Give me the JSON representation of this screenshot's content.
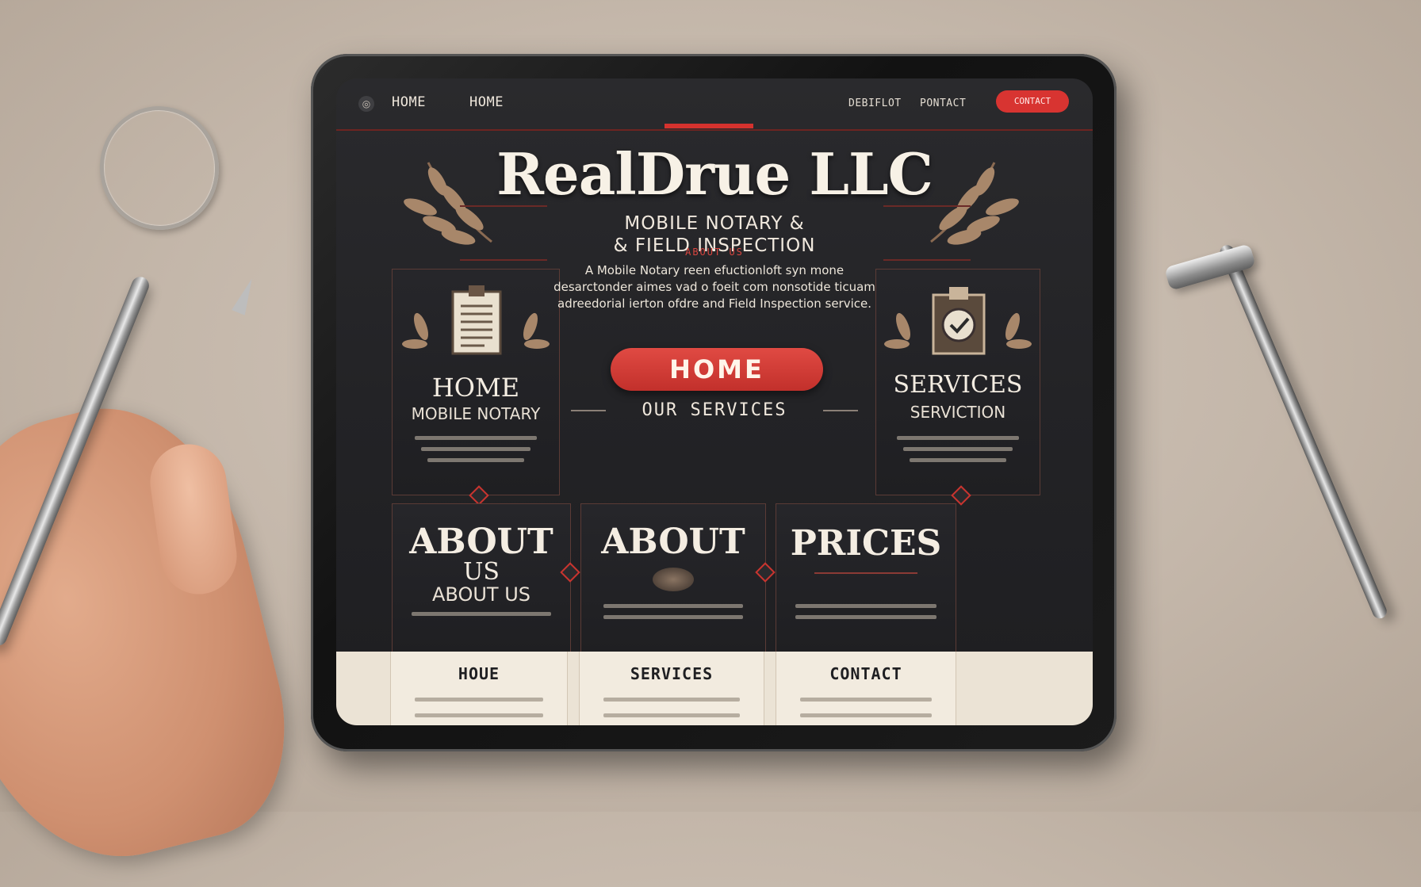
{
  "nav": {
    "links": [
      "HOME",
      "HOME"
    ],
    "right_links": [
      "DEBIFLOT",
      "PONTACT"
    ],
    "cta_label": "CONTACT"
  },
  "hero": {
    "title": "RealDrue LLC",
    "subtitle_line1": "MOBILE NOTARY &",
    "subtitle_line2": "& FIELD INSPECTION"
  },
  "intro": {
    "tag": "ABOUT US",
    "text": "A Mobile Notary reen efuctionloft syn mone desarctonder aimes vad o foeit com nonsotide ticuam adreedorial ierton ofdre and Field Inspection service.",
    "button_label": "HOME",
    "section_heading": "OUR SERVICES"
  },
  "feature_cards": [
    {
      "title": "HOME",
      "subtitle": "MOBILE NOTARY",
      "icon": "document-icon"
    },
    {
      "title": "SERVICES",
      "subtitle": "SERVICTION",
      "icon": "checklist-icon"
    }
  ],
  "info_cards": [
    {
      "title_line1": "ABOUT",
      "title_line2": "US",
      "subtitle": "ABOUT US"
    },
    {
      "title_line1": "ABOUT",
      "title_line2": "",
      "subtitle": ""
    },
    {
      "title_line1": "PRICES",
      "title_line2": "",
      "subtitle": ""
    }
  ],
  "footer_columns": [
    {
      "title": "HOUE"
    },
    {
      "title": "SERVICES"
    },
    {
      "title": "CONTACT"
    }
  ],
  "colors": {
    "accent_red": "#d5322e",
    "screen_bg": "#232326",
    "cream": "#ebe3d5"
  }
}
